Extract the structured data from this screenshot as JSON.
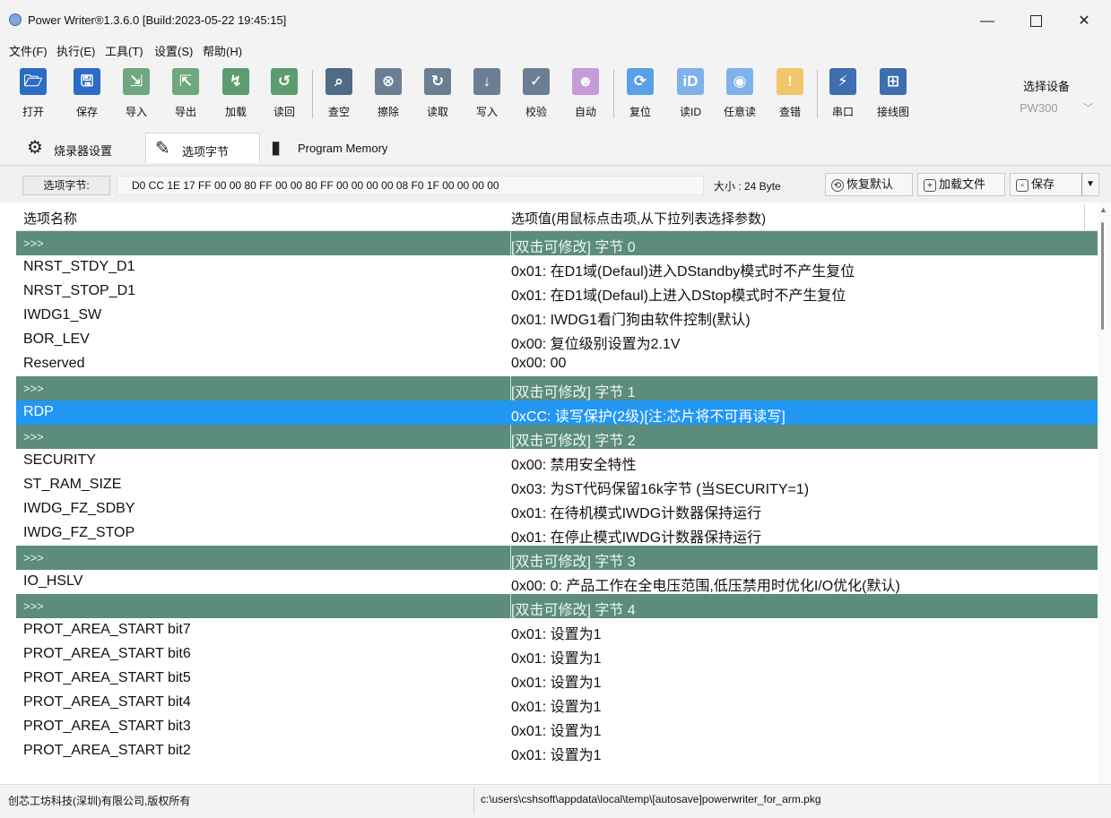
{
  "window": {
    "title": "Power Writer®1.3.6.0 [Build:2023-05-22 19:45:15]",
    "controls": {
      "minimize": "—",
      "close": "✕"
    }
  },
  "menu": [
    "文件(F)",
    "执行(E)",
    "工具(T)",
    "设置(S)",
    "帮助(H)"
  ],
  "toolbar": {
    "buttons": [
      {
        "label": "打开",
        "icon": "folder-open-icon",
        "glyph": "🗁",
        "color": "#2b6cc4"
      },
      {
        "label": "保存",
        "icon": "save-icon",
        "glyph": "🖫",
        "color": "#2b6cc4"
      },
      {
        "label": "导入",
        "icon": "import-icon",
        "glyph": "⇲",
        "color": "#6fa77e"
      },
      {
        "label": "导出",
        "icon": "export-icon",
        "glyph": "⇱",
        "color": "#6fa77e"
      },
      {
        "label": "加载",
        "icon": "load-icon",
        "glyph": "↯",
        "color": "#5c9d6f"
      },
      {
        "label": "读回",
        "icon": "readback-icon",
        "glyph": "↺",
        "color": "#5c9d6f"
      },
      {
        "label": "查空",
        "icon": "blank-check-icon",
        "glyph": "⌕",
        "color": "#4f6b86"
      },
      {
        "label": "擦除",
        "icon": "erase-icon",
        "glyph": "⊗",
        "color": "#6a7f93"
      },
      {
        "label": "读取",
        "icon": "read-icon",
        "glyph": "↻",
        "color": "#6a7f93"
      },
      {
        "label": "写入",
        "icon": "write-icon",
        "glyph": "↓",
        "color": "#6a7f93"
      },
      {
        "label": "校验",
        "icon": "verify-icon",
        "glyph": "✓",
        "color": "#6a7f93"
      },
      {
        "label": "自动",
        "icon": "robot-icon",
        "glyph": "☻",
        "color": "#c59bd8"
      },
      {
        "label": "复位",
        "icon": "reset-icon",
        "glyph": "⟳",
        "color": "#5aa0e6"
      },
      {
        "label": "读ID",
        "icon": "read-id-icon",
        "glyph": "iD",
        "color": "#7fb2ea"
      },
      {
        "label": "任意读",
        "icon": "any-read-icon",
        "glyph": "◉",
        "color": "#7fb2ea"
      },
      {
        "label": "查错",
        "icon": "error-check-icon",
        "glyph": "!",
        "color": "#f2c46c"
      },
      {
        "label": "串口",
        "icon": "serial-port-icon",
        "glyph": "⚡",
        "color": "#3d6fb0"
      },
      {
        "label": "接线图",
        "icon": "wiring-diagram-icon",
        "glyph": "⊞",
        "color": "#3d6fb0"
      }
    ],
    "select_device_label": "选择设备",
    "device_value": "PW300"
  },
  "tabs": [
    {
      "label": "烧录器设置",
      "icon": "gear-icon",
      "glyph": "⚙"
    },
    {
      "label": "选项字节",
      "icon": "option-bytes-icon",
      "glyph": "✎"
    },
    {
      "label": "Program Memory",
      "icon": "memory-icon",
      "glyph": "▮"
    }
  ],
  "option_bar": {
    "label": "选项字节:",
    "value": "D0 CC 1E 17 FF 00 00 80 FF 00 00 80 FF 00 00 00 00 08 F0 1F 00 00 00 00",
    "size": "大小 : 24 Byte",
    "restore_default": "恢复默认",
    "load_file": "加载文件",
    "save": "保存"
  },
  "grid": {
    "headers": {
      "name": "选项名称",
      "value": "选项值(用鼠标点击项,从下拉列表选择参数)"
    },
    "rows": [
      {
        "type": "group",
        "name": ">>>",
        "value": "[双击可修改] 字节 0"
      },
      {
        "type": "item",
        "name": "NRST_STDY_D1",
        "value": "0x01: 在D1域(Defaul)进入DStandby模式时不产生复位"
      },
      {
        "type": "item",
        "name": "NRST_STOP_D1",
        "value": "0x01: 在D1域(Defaul)上进入DStop模式时不产生复位"
      },
      {
        "type": "item",
        "name": "IWDG1_SW",
        "value": "0x01: IWDG1看门狗由软件控制(默认)"
      },
      {
        "type": "item",
        "name": "BOR_LEV",
        "value": "0x00: 复位级别设置为2.1V"
      },
      {
        "type": "item",
        "name": "Reserved",
        "value": "0x00: 00"
      },
      {
        "type": "group",
        "name": ">>>",
        "value": "[双击可修改] 字节 1"
      },
      {
        "type": "selected",
        "name": "RDP",
        "value": "0xCC: 读写保护(2级)[注:芯片将不可再读写]"
      },
      {
        "type": "group",
        "name": ">>>",
        "value": "[双击可修改] 字节 2"
      },
      {
        "type": "item",
        "name": "SECURITY",
        "value": "0x00: 禁用安全特性"
      },
      {
        "type": "item",
        "name": "ST_RAM_SIZE",
        "value": "0x03: 为ST代码保留16k字节 (当SECURITY=1)"
      },
      {
        "type": "item",
        "name": "IWDG_FZ_SDBY",
        "value": "0x01: 在待机模式IWDG计数器保持运行"
      },
      {
        "type": "item",
        "name": "IWDG_FZ_STOP",
        "value": "0x01: 在停止模式IWDG计数器保持运行"
      },
      {
        "type": "group",
        "name": ">>>",
        "value": "[双击可修改] 字节 3"
      },
      {
        "type": "item",
        "name": "IO_HSLV",
        "value": "0x00: 0: 产品工作在全电压范围,低压禁用时优化I/O优化(默认)"
      },
      {
        "type": "group",
        "name": ">>>",
        "value": "[双击可修改] 字节 4"
      },
      {
        "type": "item",
        "name": "PROT_AREA_START bit7",
        "value": "0x01: 设置为1"
      },
      {
        "type": "item",
        "name": "PROT_AREA_START bit6",
        "value": "0x01: 设置为1"
      },
      {
        "type": "item",
        "name": "PROT_AREA_START bit5",
        "value": "0x01: 设置为1"
      },
      {
        "type": "item",
        "name": "PROT_AREA_START bit4",
        "value": "0x01: 设置为1"
      },
      {
        "type": "item",
        "name": "PROT_AREA_START bit3",
        "value": "0x01: 设置为1"
      },
      {
        "type": "item",
        "name": "PROT_AREA_START bit2",
        "value": "0x01: 设置为1"
      }
    ]
  },
  "status": {
    "left": "创芯工坊科技(深圳)有限公司,版权所有",
    "right": "c:\\users\\cshsoft\\appdata\\local\\temp\\[autosave]powerwriter_for_arm.pkg"
  }
}
